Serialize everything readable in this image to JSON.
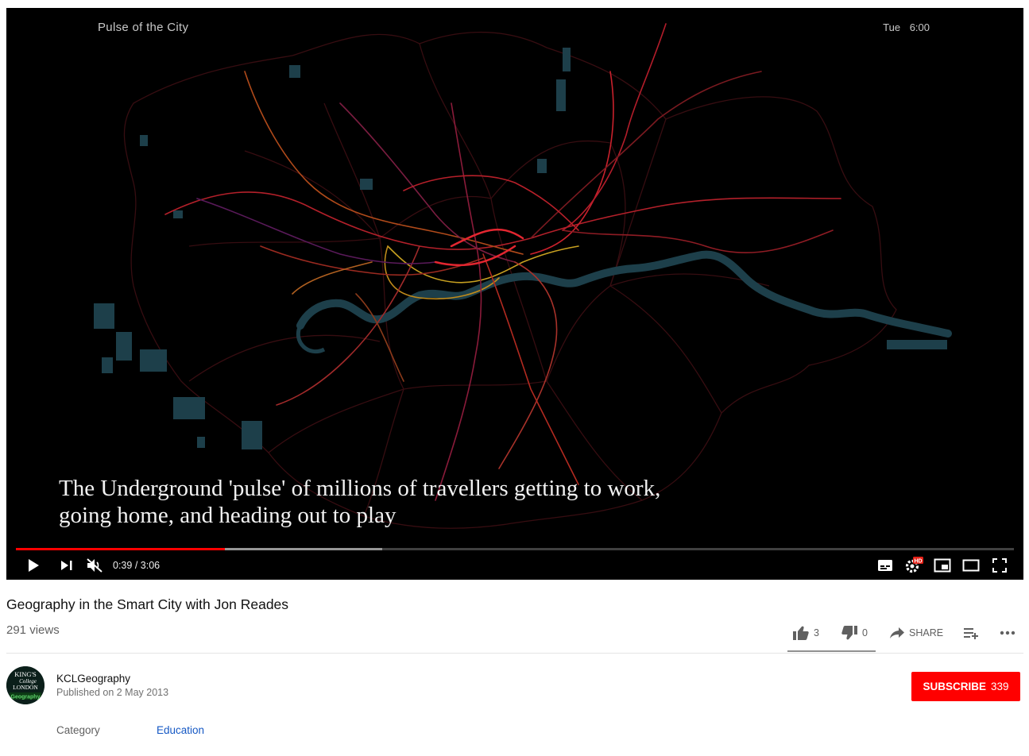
{
  "player": {
    "overlay_title": "Pulse of the City",
    "overlay_day": "Tue",
    "overlay_clock": "6:00",
    "caption_line1": "The Underground 'pulse' of millions of travellers getting to work,",
    "caption_line2": "going home, and heading out to play",
    "current_time": "0:39",
    "duration": "3:06",
    "progress_fraction": 0.209,
    "buffered_fraction": 0.367,
    "hd_badge": "HD",
    "icons": [
      "play-icon",
      "next-icon",
      "mute-icon",
      "subtitles-icon",
      "settings-icon",
      "miniplayer-icon",
      "theater-icon",
      "fullscreen-icon"
    ]
  },
  "video": {
    "title": "Geography in the Smart City with Jon Reades",
    "views": "291 views",
    "likes": "3",
    "dislikes": "0",
    "share_label": "SHARE"
  },
  "channel": {
    "name": "KCLGeography",
    "published": "Published on 2 May 2013",
    "subscribe_label": "SUBSCRIBE",
    "subscriber_count": "339",
    "logo_line1": "KING'S",
    "logo_line2": "College",
    "logo_line3": "LONDON",
    "logo_line4": "Geography"
  },
  "meta": {
    "category_label": "Category",
    "category_value": "Education"
  },
  "colors": {
    "accent": "#ff0000",
    "link": "#1558c4",
    "river": "#1d3f4a"
  }
}
